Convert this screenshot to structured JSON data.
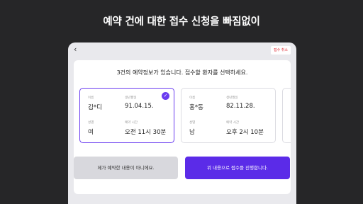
{
  "headline": "예약 건에 대한 접수 신청을 빠짐없이",
  "topbar": {
    "back_icon": "‹",
    "cancel_label": "접수 취소"
  },
  "panel": {
    "title": "3건의 예약정보가 있습니다. 접수할 환자를 선택하세요."
  },
  "cards": [
    {
      "selected": true,
      "name_label": "이름",
      "name": "김*디",
      "birth_label": "생년월일",
      "birth": "91.04.15.",
      "gender_label": "성별",
      "gender": "여",
      "time_label": "예약 시간",
      "time": "오전 11시 30분"
    },
    {
      "selected": false,
      "name_label": "이름",
      "name": "홍*동",
      "birth_label": "생년월일",
      "birth": "82.11.28.",
      "gender_label": "성별",
      "gender": "남",
      "time_label": "예약 시간",
      "time": "오후 2시 10분"
    }
  ],
  "buttons": {
    "not_mine": "제가 예약한 내용이 아니에요.",
    "proceed": "위 내용으로 접수를 진행합니다."
  },
  "colors": {
    "accent": "#5b2be8",
    "cancel_text": "#e0303a"
  }
}
